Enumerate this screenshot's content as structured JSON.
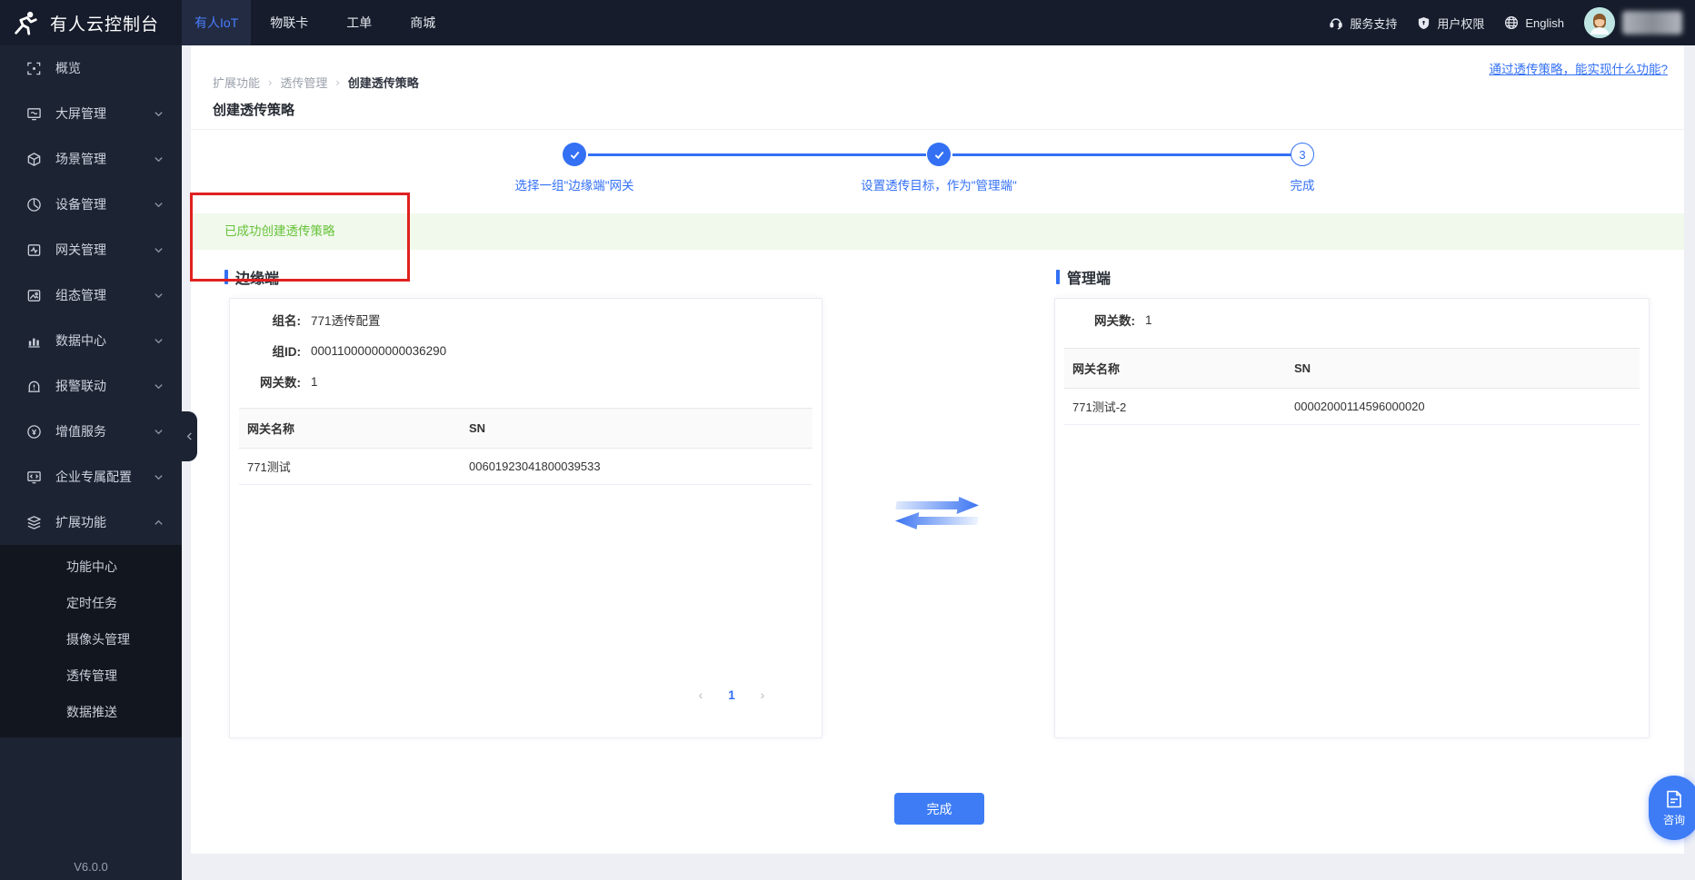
{
  "navbar": {
    "brand": "有人云控制台",
    "tabs": [
      {
        "label": "有人IoT",
        "active": true
      },
      {
        "label": "物联卡",
        "active": false
      },
      {
        "label": "工单",
        "active": false
      },
      {
        "label": "商城",
        "active": false
      }
    ],
    "support": "服务支持",
    "permissions": "用户权限",
    "language": "English"
  },
  "sidebar": {
    "items": [
      {
        "label": "概览",
        "icon": "overview-icon"
      },
      {
        "label": "大屏管理",
        "icon": "bigscreen-icon"
      },
      {
        "label": "场景管理",
        "icon": "scene-icon"
      },
      {
        "label": "设备管理",
        "icon": "device-icon"
      },
      {
        "label": "网关管理",
        "icon": "gateway-icon"
      },
      {
        "label": "组态管理",
        "icon": "scada-icon"
      },
      {
        "label": "数据中心",
        "icon": "datacenter-icon"
      },
      {
        "label": "报警联动",
        "icon": "alarm-icon"
      },
      {
        "label": "增值服务",
        "icon": "value-icon"
      },
      {
        "label": "企业专属配置",
        "icon": "enterprise-icon"
      },
      {
        "label": "扩展功能",
        "icon": "extension-icon",
        "expanded": true
      }
    ],
    "submenu": [
      {
        "label": "功能中心"
      },
      {
        "label": "定时任务"
      },
      {
        "label": "摄像头管理"
      },
      {
        "label": "透传管理"
      },
      {
        "label": "数据推送"
      }
    ],
    "version": "V6.0.0"
  },
  "header": {
    "breadcrumb": {
      "items": [
        "扩展功能",
        "透传管理",
        "创建透传策略"
      ],
      "separator": "›"
    },
    "title": "创建透传策略",
    "help_link": "通过透传策略，能实现什么功能?"
  },
  "stepper": {
    "steps": [
      {
        "label": "选择一组\"边缘端\"网关",
        "state": "done"
      },
      {
        "label": "设置透传目标，作为\"管理端\"",
        "state": "done"
      },
      {
        "label": "完成",
        "state": "current",
        "number": "3"
      }
    ]
  },
  "success_message": "已成功创建透传策略",
  "edge_panel": {
    "title": "边缘端",
    "fields": [
      {
        "label": "组名:",
        "value": "771透传配置"
      },
      {
        "label": "组ID:",
        "value": "00011000000000036290"
      },
      {
        "label": "网关数:",
        "value": "1"
      }
    ],
    "table": {
      "columns": [
        "网关名称",
        "SN"
      ],
      "rows": [
        {
          "name": "771测试",
          "sn": "00601923041800039533"
        }
      ]
    },
    "pagination": {
      "prev": "‹",
      "page": "1",
      "next": "›"
    }
  },
  "manage_panel": {
    "title": "管理端",
    "fields": [
      {
        "label": "网关数:",
        "value": "1"
      }
    ],
    "table": {
      "columns": [
        "网关名称",
        "SN"
      ],
      "rows": [
        {
          "name": "771测试-2",
          "sn": "00002000114596000020"
        }
      ]
    }
  },
  "actions": {
    "finish": "完成"
  },
  "chat": {
    "label": "咨询"
  },
  "colors": {
    "primary": "#3370f4",
    "navbar_bg": "#161c2b",
    "sidebar_bg": "#1c2433",
    "submenu_bg": "#12161f",
    "success_text": "#67c23a",
    "success_bg": "#f0f9eb",
    "annotation_red": "#e02020",
    "button_blue": "#3d7cf5"
  }
}
